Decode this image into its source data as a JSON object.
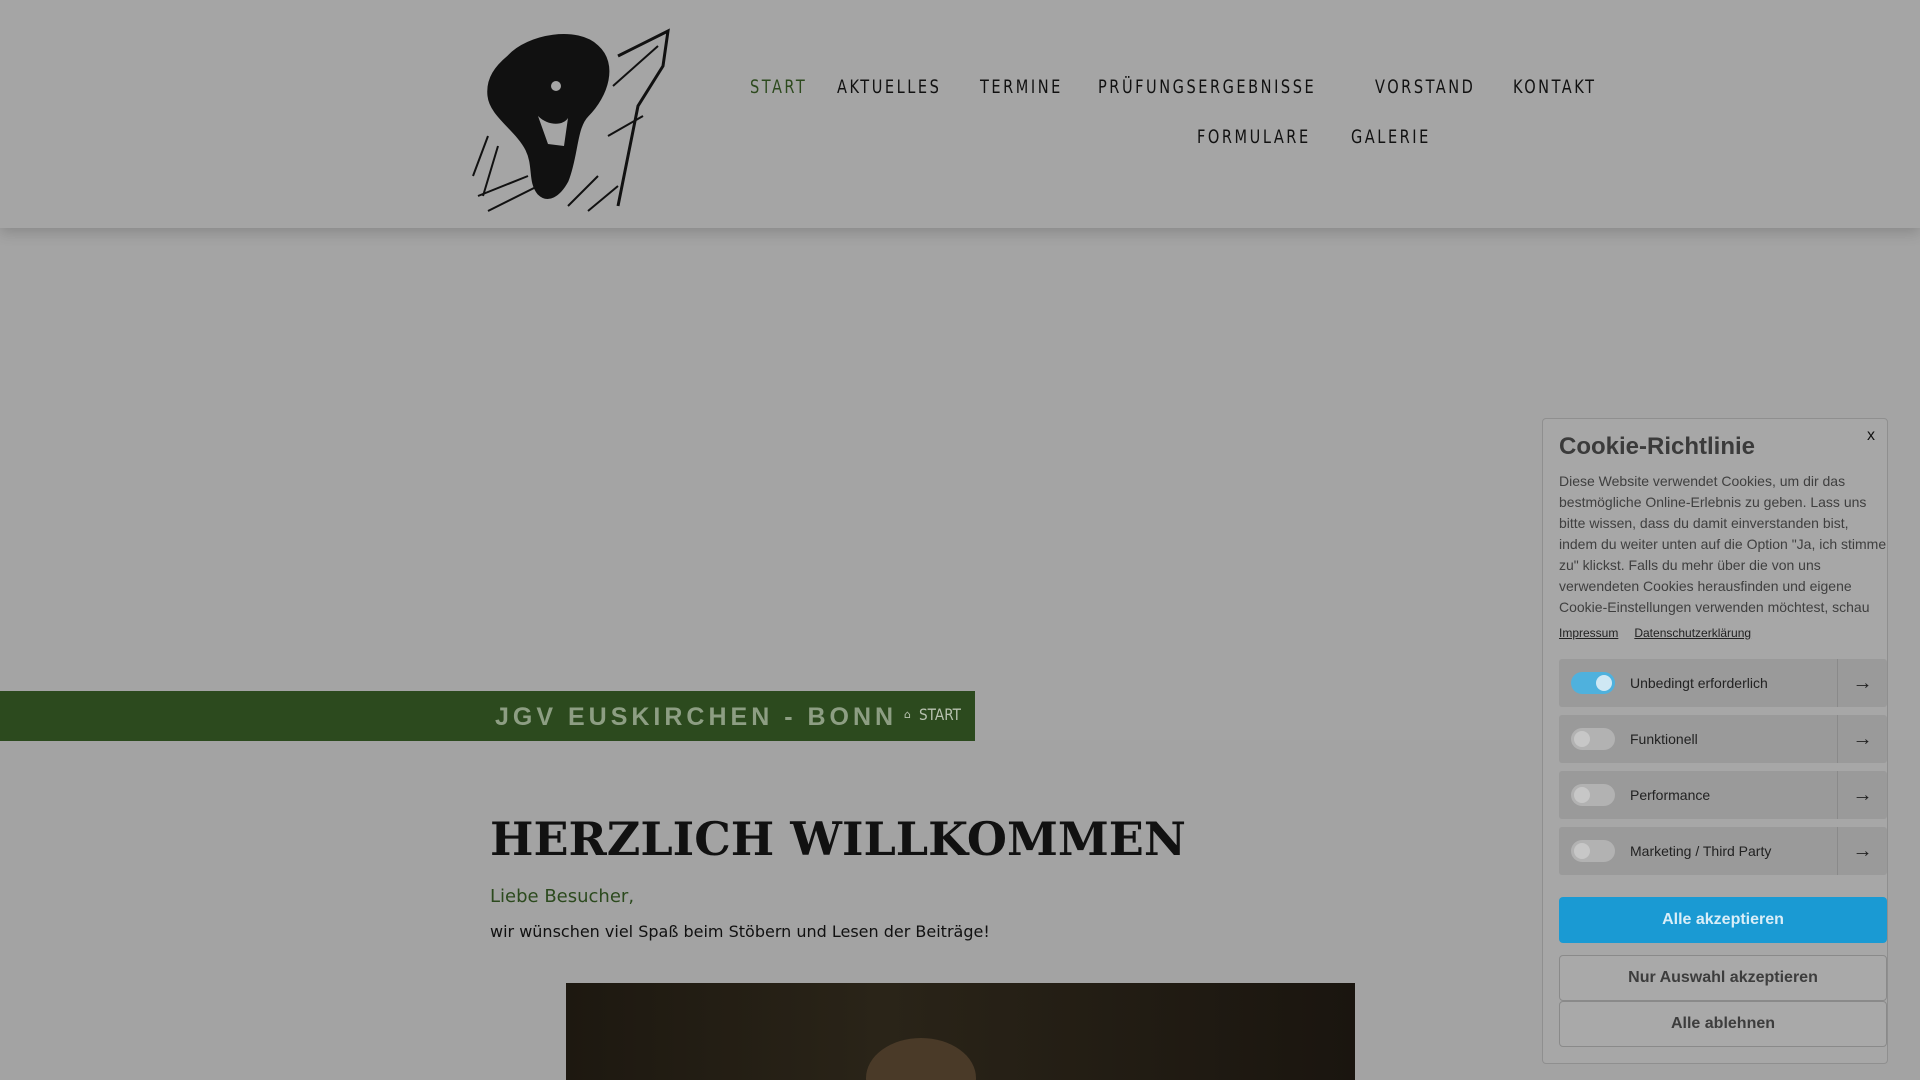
{
  "nav": {
    "row1": [
      "START",
      "AKTUELLES",
      "TERMINE",
      "PRÜFUNGSERGEBNISSE",
      "VORSTAND",
      "KONTAKT"
    ],
    "row2": [
      "FORMULARE",
      "GALERIE"
    ],
    "active": "START"
  },
  "hero": {
    "site_name": "JGV EUSKIRCHEN - BONN",
    "breadcrumb": "START"
  },
  "content": {
    "title": "HERZLICH WILLKOMMEN",
    "greeting": "Liebe Besucher,",
    "body": "wir wünschen viel Spaß beim Stöbern und Lesen der Beiträge!"
  },
  "cookie": {
    "close": "x",
    "title": "Cookie-Richtlinie",
    "text": "Diese Website verwendet Cookies, um dir das bestmögliche Online-Erlebnis zu geben. Lass uns bitte wissen, dass du damit einverstanden bist, indem du weiter unten auf die Option \"Ja, ich stimme zu\" klickst. Falls du mehr über die von uns verwendeten Cookies herausfinden und eigene Cookie-Einstellungen verwenden möchtest, schau",
    "links": [
      "Impressum",
      "Datenschutzerklärung"
    ],
    "categories": [
      {
        "label": "Unbedingt erforderlich",
        "enabled": true
      },
      {
        "label": "Funktionell",
        "enabled": false
      },
      {
        "label": "Performance",
        "enabled": false
      },
      {
        "label": "Marketing / Third Party",
        "enabled": false
      }
    ],
    "buttons": {
      "accept_all": "Alle akzeptieren",
      "accept_selection": "Nur Auswahl akzeptieren",
      "reject_all": "Alle ablehnen"
    }
  },
  "colors": {
    "accent_green": "#2c4a1e",
    "primary_button": "#1a9ad3",
    "toggle_on": "#4fb1dd"
  }
}
